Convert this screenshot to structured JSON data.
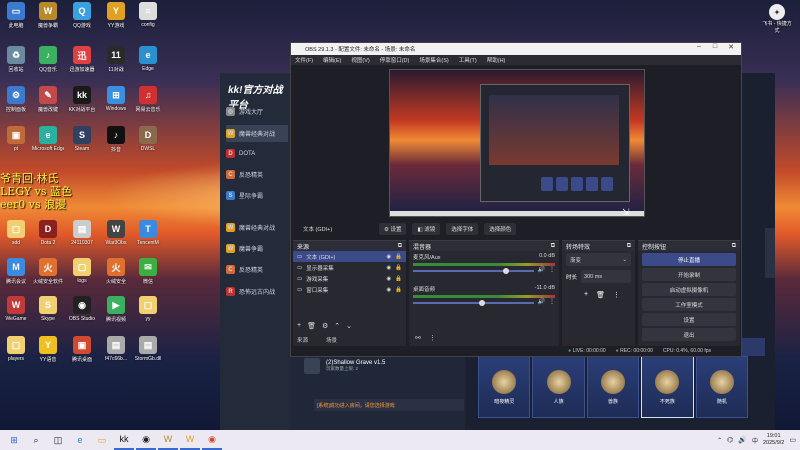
{
  "desktop": {
    "icons": [
      {
        "label": "此电脑",
        "glyph": "▭",
        "color": "#3a7ad0"
      },
      {
        "label": "魔兽争霸",
        "glyph": "W",
        "color": "#b88a2a"
      },
      {
        "label": "QQ游戏",
        "glyph": "Q",
        "color": "#3aa0e0"
      },
      {
        "label": "YY游戏",
        "glyph": "Y",
        "color": "#e0a020"
      },
      {
        "label": "config",
        "glyph": "≡",
        "color": "#ddd"
      },
      {
        "label": "回收站",
        "glyph": "♻",
        "color": "#6a8aa0"
      },
      {
        "label": "QQ音乐",
        "glyph": "♪",
        "color": "#3ab060"
      },
      {
        "label": "迅游加速器",
        "glyph": "迅",
        "color": "#e04040"
      },
      {
        "label": "11对战",
        "glyph": "11",
        "color": "#2a2a2a"
      },
      {
        "label": "Edge",
        "glyph": "e",
        "color": "#2a90d0"
      },
      {
        "label": "控制面板",
        "glyph": "⚙",
        "color": "#3a7ad0"
      },
      {
        "label": "魔兽改键",
        "glyph": "✎",
        "color": "#c04a4a"
      },
      {
        "label": "KK对战平台",
        "glyph": "kk",
        "color": "#1a1a1a"
      },
      {
        "label": "Windows",
        "glyph": "⊞",
        "color": "#3a90e0"
      },
      {
        "label": "网易云音乐",
        "glyph": "♫",
        "color": "#d03030"
      },
      {
        "label": "pt",
        "glyph": "▣",
        "color": "#c06a3a"
      },
      {
        "label": "Microsoft Edge",
        "glyph": "e",
        "color": "#2ab0a0"
      },
      {
        "label": "Steam",
        "glyph": "S",
        "color": "#304060"
      },
      {
        "label": "抖音",
        "glyph": "♪",
        "color": "#111"
      },
      {
        "label": "DWSL",
        "glyph": "D",
        "color": "#8a6a4a"
      },
      {
        "label": "sdd",
        "glyph": "▢",
        "color": "#f0d070"
      },
      {
        "label": "Dota 2",
        "glyph": "D",
        "color": "#8a2020"
      },
      {
        "label": "24110307",
        "glyph": "▤",
        "color": "#ccc"
      },
      {
        "label": "War3Obs",
        "glyph": "W",
        "color": "#444"
      },
      {
        "label": "TencentM",
        "glyph": "T",
        "color": "#3a8ae0"
      },
      {
        "label": "腾讯会议",
        "glyph": "M",
        "color": "#3a8ae0"
      },
      {
        "label": "火绒安全软件",
        "glyph": "火",
        "color": "#e07030"
      },
      {
        "label": "logs",
        "glyph": "▢",
        "color": "#f0d070"
      },
      {
        "label": "火绒安全",
        "glyph": "火",
        "color": "#e07030"
      },
      {
        "label": "微信",
        "glyph": "✉",
        "color": "#3ab040"
      },
      {
        "label": "WeGame",
        "glyph": "W",
        "color": "#c03a3a"
      },
      {
        "label": "Skype",
        "glyph": "S",
        "color": "#f0d070"
      },
      {
        "label": "OBS Studio",
        "glyph": "◉",
        "color": "#222"
      },
      {
        "label": "腾讯视频",
        "glyph": "▶",
        "color": "#3ab060"
      },
      {
        "label": "yy",
        "glyph": "▢",
        "color": "#f0d070"
      },
      {
        "label": "players",
        "glyph": "▢",
        "color": "#f0d070"
      },
      {
        "label": "YY语音",
        "glyph": "Y",
        "color": "#f0c020"
      },
      {
        "label": "腾讯桌面",
        "glyph": "▣",
        "color": "#d04a30"
      },
      {
        "label": "f47c66b...",
        "glyph": "▤",
        "color": "#aaa"
      },
      {
        "label": "StormGb.dll",
        "glyph": "▤",
        "color": "#aaa"
      }
    ],
    "overlay_lines": [
      "爷青回·林氏",
      "LEGY vs 蓝色",
      "eer0 vs 浪漫"
    ],
    "right_icon_label": "飞书 - 快捷方式"
  },
  "game_client": {
    "logo": "kk!官方对战平台",
    "nav": [
      {
        "label": "游戏大厅",
        "glyph": "◎",
        "color": "#888"
      },
      {
        "label": "魔兽经典对战",
        "glyph": "W",
        "color": "#e0a020"
      },
      {
        "label": "DOTA",
        "glyph": "D",
        "color": "#c03030"
      },
      {
        "label": "反恐精英",
        "glyph": "C",
        "color": "#d06a3a"
      },
      {
        "label": "星际争霸",
        "glyph": "S",
        "color": "#3a7ad0"
      },
      {
        "label": "魔兽经典对战",
        "glyph": "W",
        "color": "#e0a020"
      },
      {
        "label": "魔兽争霸",
        "glyph": "W",
        "color": "#e0a020"
      },
      {
        "label": "反恐精英",
        "glyph": "C",
        "color": "#d06a3a"
      },
      {
        "label": "恐怖远古内战",
        "glyph": "R",
        "color": "#c03030"
      }
    ],
    "list_item_title": "(2)Shallow Grave v1.5",
    "list_item_sub": "玩家数量上限: 2",
    "notice": "[系统]成功进入房间，请您选择游戏",
    "races": [
      {
        "label": "暗夜精灵",
        "selected": false
      },
      {
        "label": "人族",
        "selected": false
      },
      {
        "label": "兽族",
        "selected": false
      },
      {
        "label": "不死族",
        "selected": true
      },
      {
        "label": "随机",
        "selected": false
      }
    ]
  },
  "obs": {
    "title": "OBS 29.1.3 - 配置文件: 未命名 - 场景: 未命名",
    "menu": [
      "文件(F)",
      "编辑(E)",
      "视图(V)",
      "停靠窗口(D)",
      "场景集合(S)",
      "工具(T)",
      "帮助(H)"
    ],
    "source_toolbar": {
      "selected": "文本 (GDI+)",
      "settings": "设置",
      "filters": "滤镜",
      "select_font": "选择字体",
      "select_color": "选择颜色"
    },
    "sources_title": "来源",
    "sources": [
      {
        "name": "文本 (GDI+)",
        "selected": true
      },
      {
        "name": "显示器采集",
        "selected": false
      },
      {
        "name": "游戏采集",
        "selected": false
      },
      {
        "name": "窗口采集",
        "selected": false
      }
    ],
    "sources_bottom_tabs": [
      "来源",
      "场景"
    ],
    "mixer_title": "混音器",
    "mixer": [
      {
        "name": "麦克风/Aux",
        "db": "0.0 dB",
        "level": 0.75
      },
      {
        "name": "桌面音频",
        "db": "-11.0 dB",
        "level": 0.55
      }
    ],
    "transitions_title": "转场特效",
    "transition_name": "渐变",
    "duration_label": "时长",
    "duration_value": "300 ms",
    "controls_title": "控制按钮",
    "controls": [
      "停止直播",
      "开始录制",
      "启动虚拟摄像机",
      "工作室模式",
      "设置",
      "退出"
    ],
    "status": {
      "live": "LIVE: 00:00:00",
      "rec": "REC: 00:00:00",
      "cpu": "CPU: 0.4%, 60.00 fps"
    }
  },
  "taskbar": {
    "icons": [
      {
        "glyph": "⊞",
        "color": "#2a6ad0"
      },
      {
        "glyph": "⌕",
        "color": "#222"
      },
      {
        "glyph": "◫",
        "color": "#222"
      },
      {
        "glyph": "e",
        "color": "#2a90d0"
      },
      {
        "glyph": "▭",
        "color": "#e0a020"
      },
      {
        "glyph": "kk",
        "color": "#111"
      },
      {
        "glyph": "◉",
        "color": "#222"
      },
      {
        "glyph": "W",
        "color": "#b88a2a"
      },
      {
        "glyph": "W",
        "color": "#e0a020"
      },
      {
        "glyph": "◉",
        "color": "#d04a30"
      }
    ],
    "time": "19:01",
    "date": "2025/9/2",
    "lang": "中"
  }
}
